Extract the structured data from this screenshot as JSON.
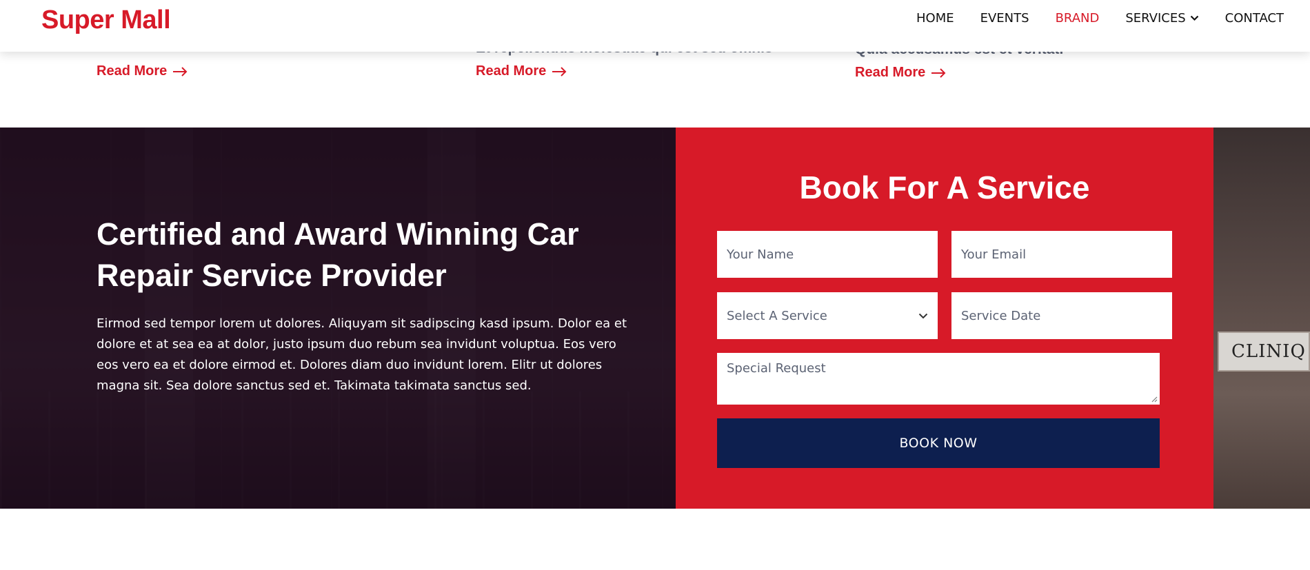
{
  "brand": "Super Mall",
  "nav": {
    "home": "HOME",
    "events": "EVENTS",
    "brand": "BRAND",
    "services": "SERVICES",
    "contact": "CONTACT"
  },
  "cards": [
    {
      "clipped_text": "",
      "read_more": "Read More"
    },
    {
      "clipped_text": "Et repellendus molestiae qui est sed omnis",
      "read_more": "Read More"
    },
    {
      "clipped_text": "Quia accusamus est et veritat.",
      "read_more": "Read More"
    }
  ],
  "hero": {
    "headline_line1": "Certified and Award Winning Car",
    "headline_line2": "Repair Service Provider",
    "body": "Eirmod sed tempor lorem ut dolores. Aliquyam sit sadipscing kasd ipsum. Dolor ea et dolore et at sea ea at dolor, justo ipsum duo rebum sea invidunt voluptua. Eos vero eos vero ea et dolore eirmod et. Dolores diam duo invidunt lorem. Elitr ut dolores magna sit. Sea dolore sanctus sed et. Takimata takimata sanctus sed.",
    "background_sign": "CLINIQ"
  },
  "booking": {
    "title": "Book For A Service",
    "name_placeholder": "Your Name",
    "email_placeholder": "Your Email",
    "service_placeholder": "Select A Service",
    "date_placeholder": "Service Date",
    "request_placeholder": "Special Request",
    "submit_label": "BOOK NOW"
  },
  "colors": {
    "accent_red": "#d71a28",
    "button_navy": "#0d1f4f"
  }
}
